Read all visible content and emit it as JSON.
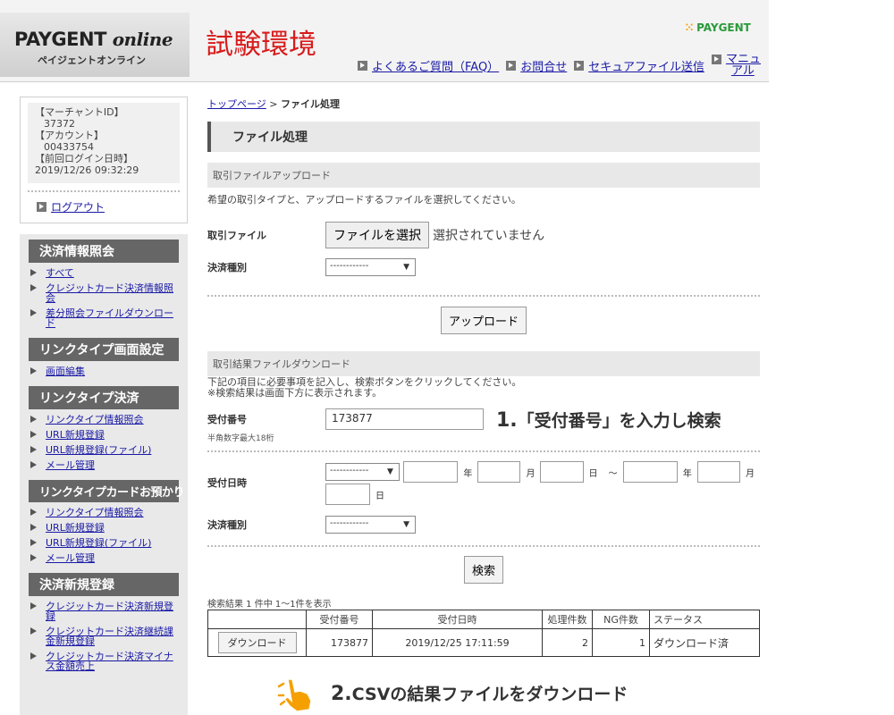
{
  "header": {
    "logo_main": "PAYGENT",
    "logo_italic": "online",
    "logo_sub": "ペイジェントオンライン",
    "env_title": "試験環境",
    "brand": "PAYGENT",
    "nav": [
      "よくあるご質問（FAQ）",
      "お問合せ",
      "セキュアファイル送信"
    ],
    "nav_manual_1": "マニュ",
    "nav_manual_2": "アル"
  },
  "account": {
    "merchant_label": "【マーチャントID】",
    "merchant_id": "37372",
    "account_label": "【アカウント】",
    "account_id": "00433754",
    "last_login_label": "【前回ログイン日時】",
    "last_login": "2019/12/26 09:32:29",
    "logout": "ログアウト"
  },
  "sidebar": {
    "sections": [
      {
        "title": "決済情報照会",
        "items": [
          "すべて",
          "クレジットカード決済情報照会",
          "差分照会ファイルダウンロード"
        ]
      },
      {
        "title": "リンクタイプ画面設定",
        "items": [
          "画面編集"
        ]
      },
      {
        "title": "リンクタイプ決済",
        "items": [
          "リンクタイプ情報照会",
          "URL新規登録",
          "URL新規登録(ファイル)",
          "メール管理"
        ]
      },
      {
        "title": "リンクタイプカードお預かり",
        "items": [
          "リンクタイプ情報照会",
          "URL新規登録",
          "URL新規登録(ファイル)",
          "メール管理"
        ]
      },
      {
        "title": "決済新規登録",
        "items": [
          "クレジットカード決済新規登録",
          "クレジットカード決済継続課金新規登録",
          "クレジットカード決済マイナス金額売上"
        ]
      }
    ]
  },
  "breadcrumb": {
    "home": "トップページ",
    "sep": ">",
    "current": "ファイル処理"
  },
  "page_title": "ファイル処理",
  "upload": {
    "section": "取引ファイルアップロード",
    "desc": "希望の取引タイプと、アップロードするファイルを選択してください。",
    "file_label": "取引ファイル",
    "file_button": "ファイルを選択",
    "file_status": "選択されていません",
    "type_label": "決済種別",
    "type_value": "------------",
    "upload_button": "アップロード"
  },
  "download": {
    "section": "取引結果ファイルダウンロード",
    "desc1": "下記の項目に必要事項を記入し、検索ボタンをクリックしてください。",
    "desc2": "※検索結果は画面下方に表示されます。",
    "receipt_label": "受付番号",
    "receipt_note": "半角数字最大18桁",
    "receipt_value": "173877",
    "date_label": "受付日時",
    "date_select": "------------",
    "unit_year": "年",
    "unit_month": "月",
    "unit_day": "日",
    "tilde": "～",
    "type_label": "決済種別",
    "type_value": "------------",
    "search_button": "検索"
  },
  "annotations": {
    "step1_num": "1.",
    "step1_text": "「受付番号」を入力し検索",
    "step2_num": "2.",
    "step2_text": "CSVの結果ファイルをダウンロード"
  },
  "results": {
    "summary": "検索結果 1 件中 1～1件を表示",
    "columns": [
      "",
      "受付番号",
      "受付日時",
      "処理件数",
      "NG件数",
      "ステータス"
    ],
    "rows": [
      {
        "button": "ダウンロード",
        "receipt": "173877",
        "datetime": "2019/12/25 17:11:59",
        "processed": "2",
        "ng": "1",
        "status": "ダウンロード済"
      }
    ]
  },
  "colors": {
    "env_red": "#d81b1b",
    "brand_green": "#2a9a3a",
    "hand_orange": "#f5a000"
  }
}
